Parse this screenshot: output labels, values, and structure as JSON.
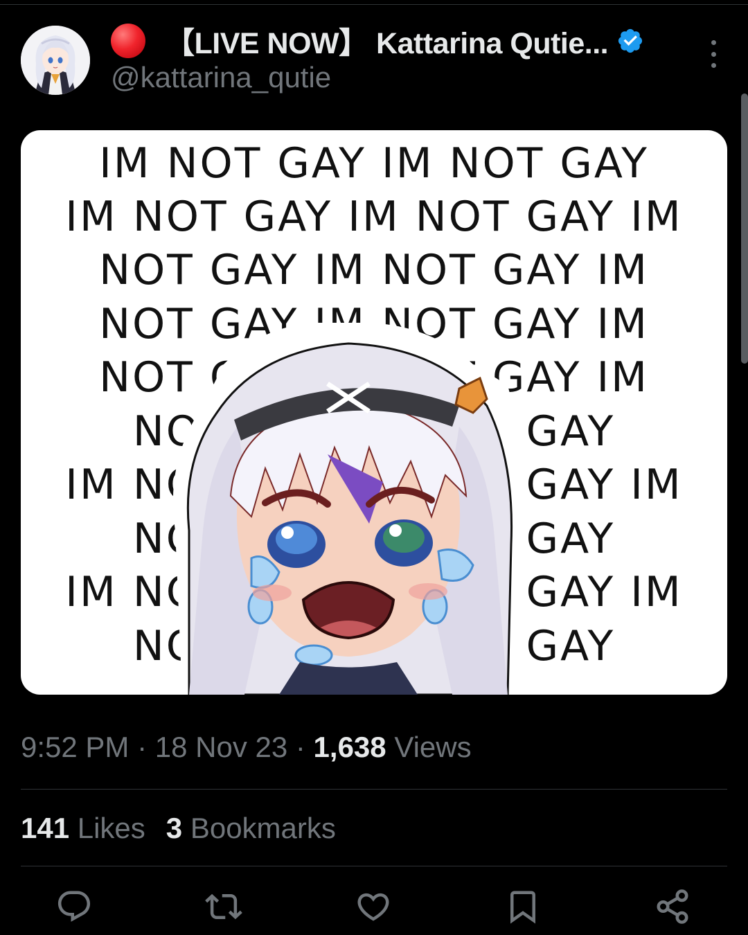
{
  "tweet": {
    "live_dot_color": "#f0242c",
    "display_name": "【LIVE NOW】 Kattarina Qutie...",
    "verified": true,
    "handle": "@kattarina_qutie",
    "icons": [
      "avatar-image",
      "verified-badge-icon",
      "more-options-icon"
    ]
  },
  "media": {
    "text_lines": [
      "IM NOT GAY  IM NOT GAY",
      "IM NOT GAY  IM NOT GAY  IM",
      "NOT GAY  IM NOT GAY  IM",
      "NOT GAY  IM NOT  GAY  IM",
      "NOT GAY  IM NOT GAY  IM",
      "NOT GAY  IM NOT GAY",
      "IM NOT GAY  IM NOT GAY  IM",
      "NOT GAY  IM NOT GAY",
      "IM NOT GAY  IM NOT GAY  IM",
      "NOT GAY  IM NOT GAY"
    ],
    "overlay": "crying-anime-girl-emote"
  },
  "meta": {
    "time": "9:52 PM",
    "sep1": " · ",
    "date": "18 Nov 23",
    "sep2": " · ",
    "views_count": "1,638",
    "views_label": " Views"
  },
  "stats": {
    "likes_count": "141",
    "likes_label": " Likes",
    "bookmarks_count": "3",
    "bookmarks_label": " Bookmarks"
  },
  "actions": {
    "icons": [
      "reply-icon",
      "repost-icon",
      "like-icon",
      "bookmark-icon",
      "share-icon"
    ],
    "icon_color": "#71767b"
  }
}
